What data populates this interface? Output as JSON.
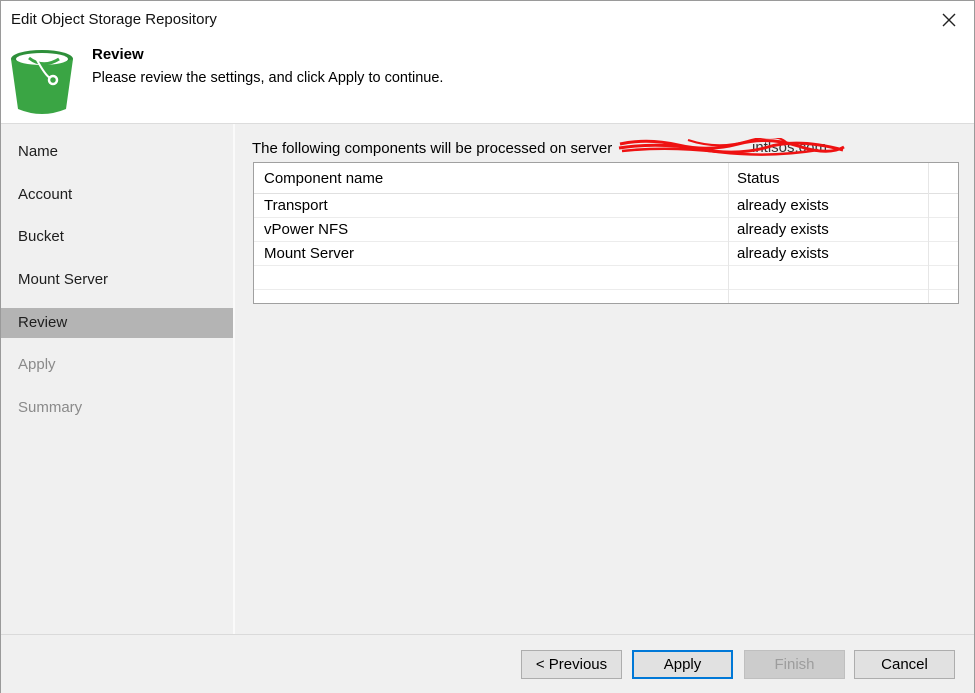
{
  "window": {
    "title": "Edit Object Storage Repository"
  },
  "header": {
    "title": "Review",
    "subtitle": "Please review the settings, and click Apply to continue.",
    "icon": "bucket-icon",
    "accent": "#3aa544"
  },
  "sidebar": {
    "items": [
      {
        "label": "Name",
        "state": "normal"
      },
      {
        "label": "Account",
        "state": "normal"
      },
      {
        "label": "Bucket",
        "state": "normal"
      },
      {
        "label": "Mount Server",
        "state": "normal"
      },
      {
        "label": "Review",
        "state": "active"
      },
      {
        "label": "Apply",
        "state": "disabled"
      },
      {
        "label": "Summary",
        "state": "disabled"
      }
    ]
  },
  "main": {
    "intro": "The following components will be processed on server",
    "server_visible_suffix": "intlsos.com",
    "table": {
      "columns": [
        "Component name",
        "Status"
      ],
      "rows": [
        [
          "Transport",
          "already exists"
        ],
        [
          "vPower NFS",
          "already exists"
        ],
        [
          "Mount Server",
          "already exists"
        ]
      ]
    }
  },
  "footer": {
    "previous_label": "< Previous",
    "apply_label": "Apply",
    "finish_label": "Finish",
    "cancel_label": "Cancel"
  }
}
